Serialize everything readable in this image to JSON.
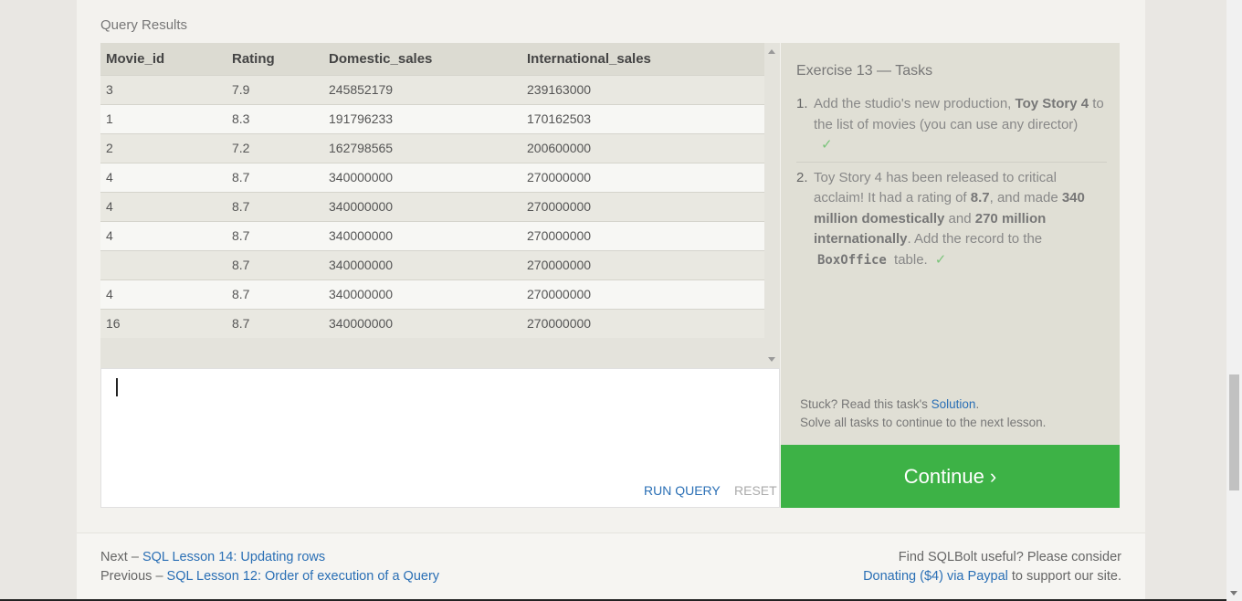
{
  "results": {
    "title": "Query Results",
    "columns": [
      "Movie_id",
      "Rating",
      "Domestic_sales",
      "International_sales"
    ],
    "rows": [
      [
        "3",
        "7.9",
        "245852179",
        "239163000"
      ],
      [
        "1",
        "8.3",
        "191796233",
        "170162503"
      ],
      [
        "2",
        "7.2",
        "162798565",
        "200600000"
      ],
      [
        "4",
        "8.7",
        "340000000",
        "270000000"
      ],
      [
        "4",
        "8.7",
        "340000000",
        "270000000"
      ],
      [
        "4",
        "8.7",
        "340000000",
        "270000000"
      ],
      [
        "",
        "8.7",
        "340000000",
        "270000000"
      ],
      [
        "4",
        "8.7",
        "340000000",
        "270000000"
      ],
      [
        "16",
        "8.7",
        "340000000",
        "270000000"
      ]
    ]
  },
  "editor": {
    "run_label": "RUN QUERY",
    "reset_label": "RESET"
  },
  "tasks": {
    "title": "Exercise 13 — Tasks",
    "items": [
      {
        "num": "1.",
        "pre": "Add the studio's new production, ",
        "bold1": "Toy Story 4",
        "post": " to the list of movies (you can use any director)",
        "check": "✓"
      },
      {
        "num": "2.",
        "t1": "Toy Story 4 has been released to critical acclaim! It had a rating of ",
        "b1": "8.7",
        "t2": ", and made ",
        "b2": "340 million domestically",
        "t3": " and ",
        "b3": "270 million internationally",
        "t4": ". Add the record to the ",
        "code": "BoxOffice",
        "t5": " table.",
        "check": "✓"
      }
    ],
    "stuck_prefix": "Stuck? Read this task's ",
    "stuck_link": "Solution",
    "stuck_suffix": ".",
    "solve_note": "Solve all tasks to continue to the next lesson."
  },
  "continue_label": "Continue ›",
  "footer": {
    "next_prefix": "Next – ",
    "next_link": "SQL Lesson 14: Updating rows",
    "prev_prefix": "Previous – ",
    "prev_link": "SQL Lesson 12: Order of execution of a Query",
    "right_line1": "Find SQLBolt useful? Please consider",
    "donate_link": "Donating ($4) via Paypal",
    "right_suffix": " to support our site."
  }
}
